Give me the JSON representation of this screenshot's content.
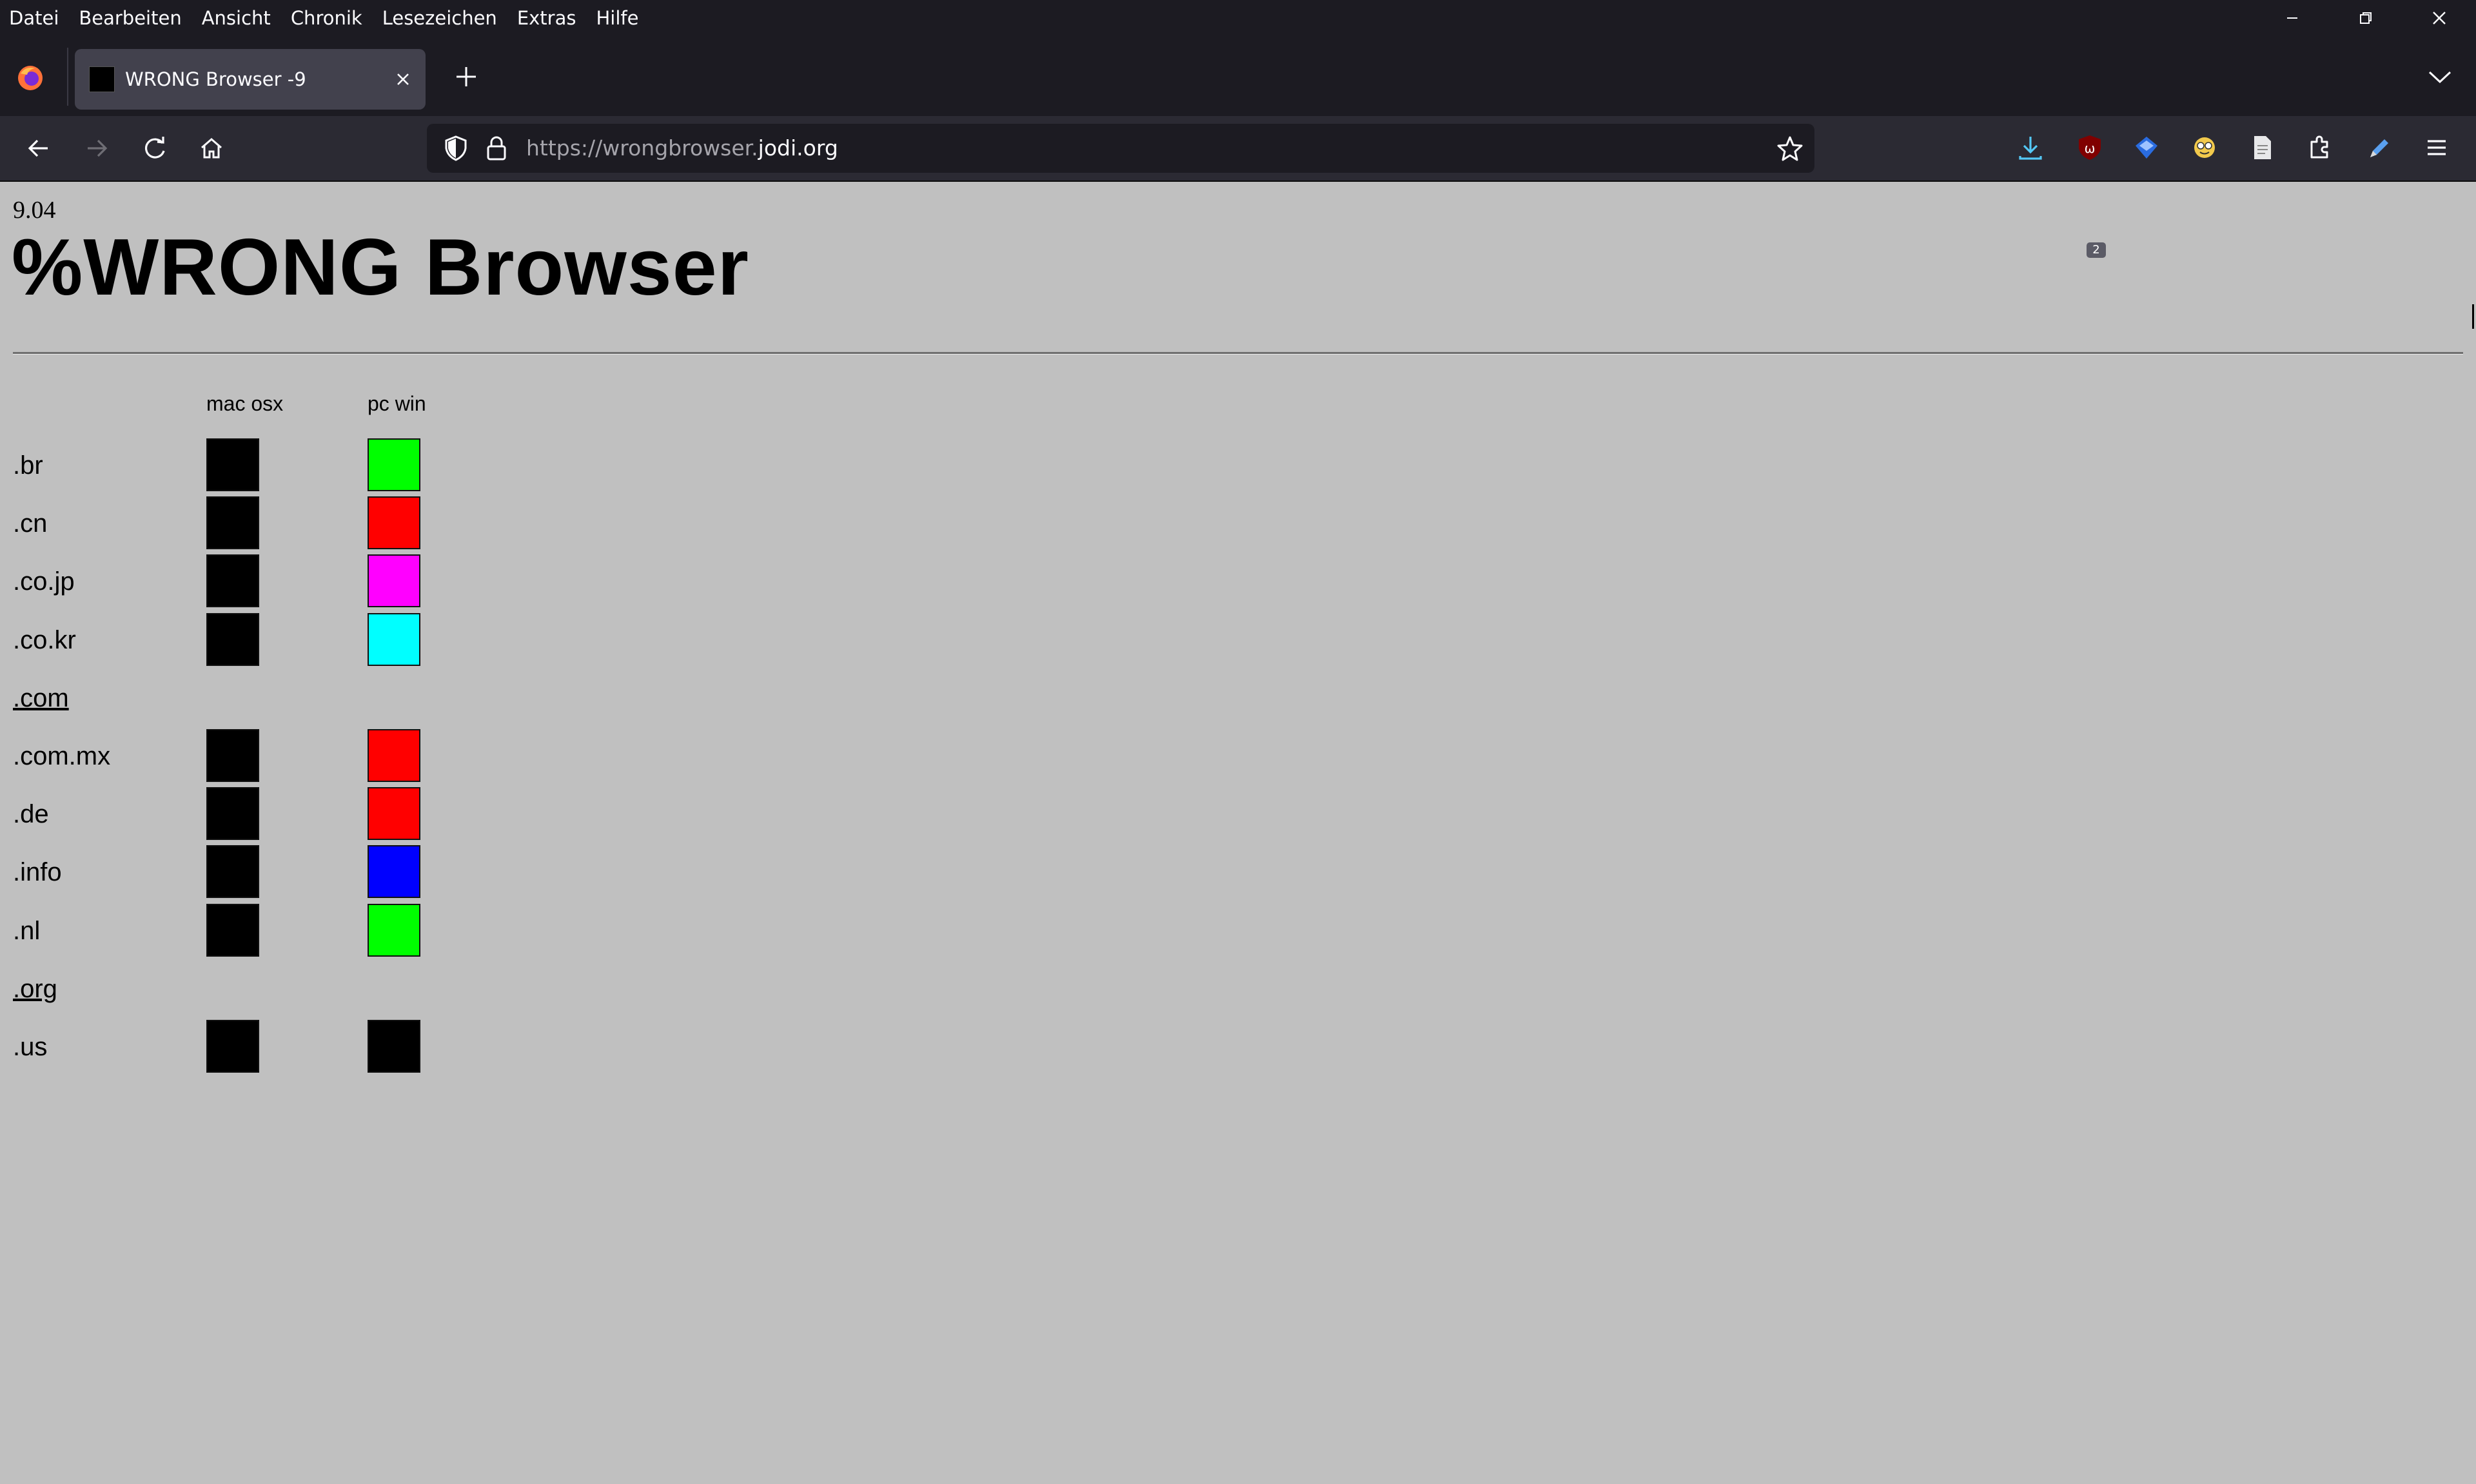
{
  "menubar": {
    "items": [
      "Datei",
      "Bearbeiten",
      "Ansicht",
      "Chronik",
      "Lesezeichen",
      "Extras",
      "Hilfe"
    ]
  },
  "window_controls": [
    "minimize-icon",
    "restore-icon",
    "close-icon"
  ],
  "tab": {
    "title": "WRONG Browser -9"
  },
  "address_bar": {
    "url_prefix": "https://wrongbrowser.",
    "url_domain": "jodi.org",
    "extension_badge": "2"
  },
  "page": {
    "version": "9.04",
    "title": "%WRONG Browser",
    "columns": [
      "mac osx",
      "pc win"
    ],
    "rows": [
      {
        "label": ".br",
        "link": false,
        "mac": "#000000",
        "pc": "#00ff00"
      },
      {
        "label": ".cn",
        "link": false,
        "mac": "#000000",
        "pc": "#ff0000"
      },
      {
        "label": ".co.jp",
        "link": false,
        "mac": "#000000",
        "pc": "#ff00ff"
      },
      {
        "label": ".co.kr",
        "link": false,
        "mac": "#000000",
        "pc": "#00ffff"
      },
      {
        "label": ".com",
        "link": true,
        "mac": null,
        "pc": null
      },
      {
        "label": ".com.mx",
        "link": false,
        "mac": "#000000",
        "pc": "#ff0000"
      },
      {
        "label": ".de",
        "link": false,
        "mac": "#000000",
        "pc": "#ff0000"
      },
      {
        "label": ".info",
        "link": false,
        "mac": "#000000",
        "pc": "#0000ff"
      },
      {
        "label": ".nl",
        "link": false,
        "mac": "#000000",
        "pc": "#00ff00"
      },
      {
        "label": ".org",
        "link": true,
        "mac": null,
        "pc": null
      },
      {
        "label": ".us",
        "link": false,
        "mac": "#000000",
        "pc": "#000000"
      }
    ]
  },
  "colors": {
    "chrome_dark": "#1c1b22",
    "toolbar": "#2b2a33",
    "page_background": "#c0c0c0"
  }
}
